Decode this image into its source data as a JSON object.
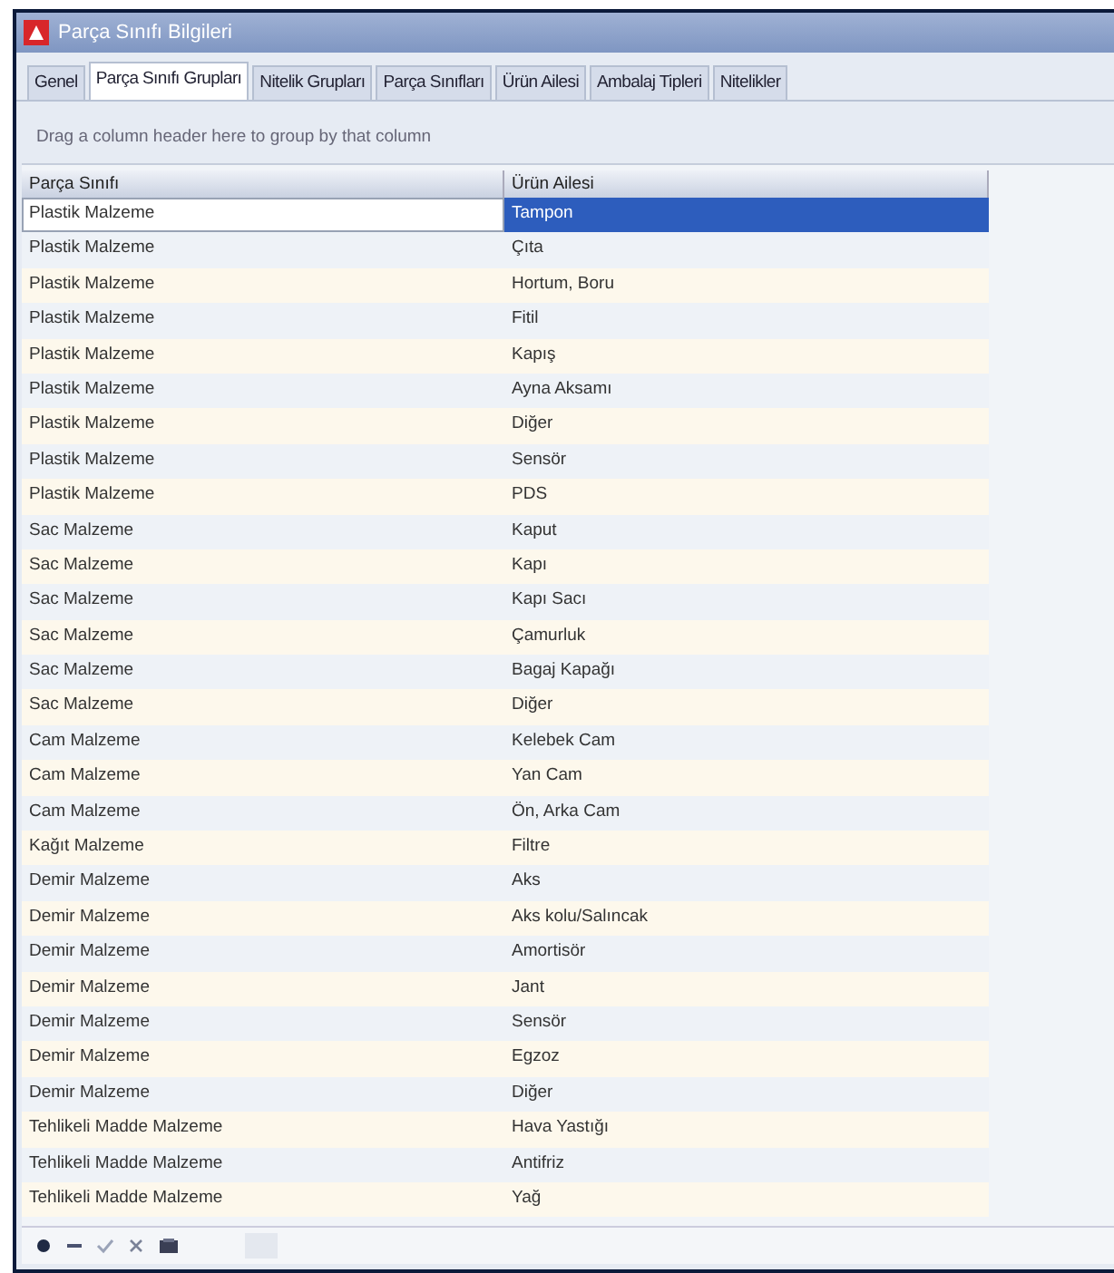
{
  "window": {
    "title": "Parça Sınıfı Bilgileri"
  },
  "tabs": [
    {
      "label": "Genel",
      "selected": false
    },
    {
      "label": "Parça Sınıfı Grupları",
      "selected": true
    },
    {
      "label": "Nitelik Grupları",
      "selected": false
    },
    {
      "label": "Parça Sınıfları",
      "selected": false
    },
    {
      "label": "Ürün Ailesi",
      "selected": false
    },
    {
      "label": "Ambalaj Tipleri",
      "selected": false
    },
    {
      "label": "Nitelikler",
      "selected": false
    }
  ],
  "group_panel": {
    "hint": "Drag a column header here to group by that column"
  },
  "table": {
    "columns": [
      "Parça Sınıfı",
      "Ürün Ailesi"
    ],
    "rows": [
      {
        "cells": [
          "Plastik Malzeme",
          "Tampon"
        ],
        "selected": true
      },
      {
        "cells": [
          "Plastik Malzeme",
          "Çıta"
        ],
        "selected": false
      },
      {
        "cells": [
          "Plastik Malzeme",
          "Hortum, Boru"
        ],
        "selected": false
      },
      {
        "cells": [
          "Plastik Malzeme",
          "Fitil"
        ],
        "selected": false
      },
      {
        "cells": [
          "Plastik Malzeme",
          "Kapış"
        ],
        "selected": false
      },
      {
        "cells": [
          "Plastik Malzeme",
          "Ayna Aksamı"
        ],
        "selected": false
      },
      {
        "cells": [
          "Plastik Malzeme",
          "Diğer"
        ],
        "selected": false
      },
      {
        "cells": [
          "Plastik Malzeme",
          "Sensör"
        ],
        "selected": false
      },
      {
        "cells": [
          "Plastik Malzeme",
          "PDS"
        ],
        "selected": false
      },
      {
        "cells": [
          "Sac Malzeme",
          "Kaput"
        ],
        "selected": false
      },
      {
        "cells": [
          "Sac Malzeme",
          "Kapı"
        ],
        "selected": false
      },
      {
        "cells": [
          "Sac Malzeme",
          "Kapı Sacı"
        ],
        "selected": false
      },
      {
        "cells": [
          "Sac Malzeme",
          "Çamurluk"
        ],
        "selected": false
      },
      {
        "cells": [
          "Sac Malzeme",
          "Bagaj Kapağı"
        ],
        "selected": false
      },
      {
        "cells": [
          "Sac Malzeme",
          "Diğer"
        ],
        "selected": false
      },
      {
        "cells": [
          "Cam Malzeme",
          "Kelebek Cam"
        ],
        "selected": false
      },
      {
        "cells": [
          "Cam Malzeme",
          "Yan Cam"
        ],
        "selected": false
      },
      {
        "cells": [
          "Cam Malzeme",
          "Ön, Arka Cam"
        ],
        "selected": false
      },
      {
        "cells": [
          "Kağıt Malzeme",
          "Filtre"
        ],
        "selected": false
      },
      {
        "cells": [
          "Demir Malzeme",
          "Aks"
        ],
        "selected": false
      },
      {
        "cells": [
          "Demir Malzeme",
          "Aks kolu/Salıncak"
        ],
        "selected": false
      },
      {
        "cells": [
          "Demir Malzeme",
          "Amortisör"
        ],
        "selected": false
      },
      {
        "cells": [
          "Demir Malzeme",
          "Jant"
        ],
        "selected": false
      },
      {
        "cells": [
          "Demir Malzeme",
          "Sensör"
        ],
        "selected": false
      },
      {
        "cells": [
          "Demir Malzeme",
          "Egzoz"
        ],
        "selected": false
      },
      {
        "cells": [
          "Demir Malzeme",
          "Diğer"
        ],
        "selected": false
      },
      {
        "cells": [
          "Tehlikeli Madde Malzeme",
          "Hava Yastığı"
        ],
        "selected": false
      },
      {
        "cells": [
          "Tehlikeli Madde Malzeme",
          "Antifriz"
        ],
        "selected": false
      },
      {
        "cells": [
          "Tehlikeli Madde Malzeme",
          "Yağ"
        ],
        "selected": false
      }
    ]
  }
}
